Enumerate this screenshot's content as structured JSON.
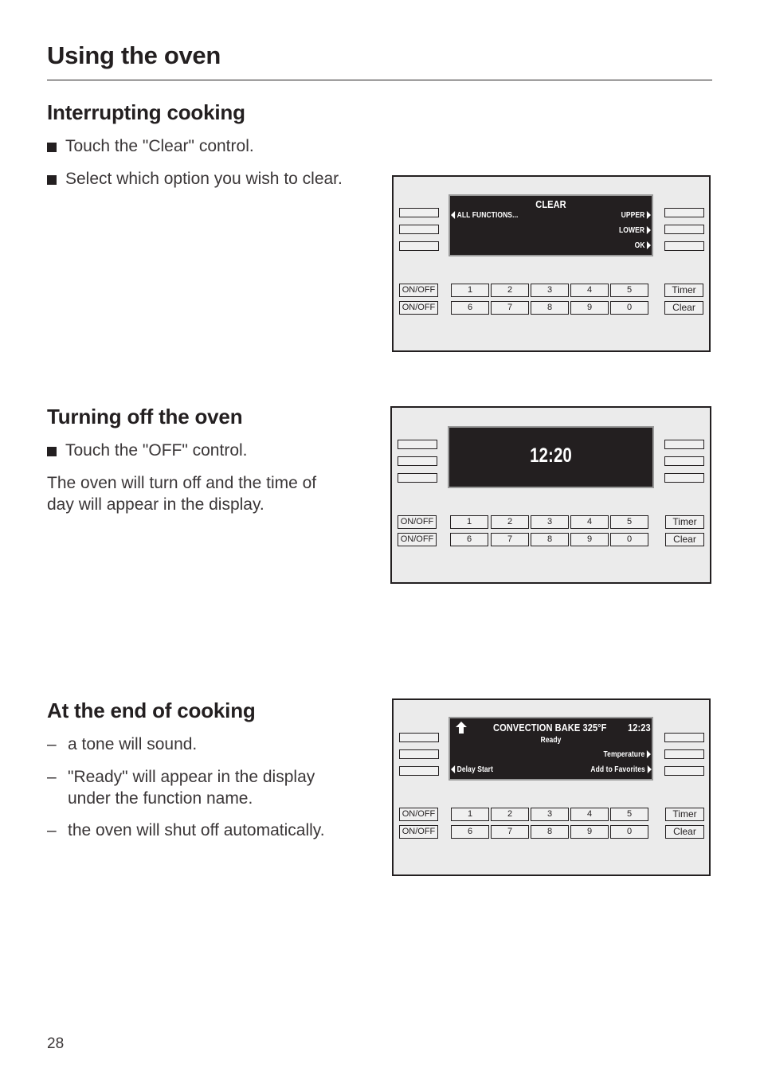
{
  "page": {
    "title": "Using the oven",
    "page_number": "28"
  },
  "sections": [
    {
      "heading": "Interrupting cooking",
      "bullets": [
        "Touch the \"Clear\" control.",
        "Select which option you wish to clear."
      ]
    },
    {
      "heading": "Turning off the oven",
      "bullets": [
        "Touch the \"OFF\" control."
      ],
      "paragraph_lines": [
        "The oven will turn off and the time of",
        "day will appear in the display."
      ]
    },
    {
      "heading": "At the end of cooking",
      "dash_marker": "–",
      "dash_items": [
        [
          "a tone will sound."
        ],
        [
          "\"Ready\" will appear in the display",
          "under the function name."
        ],
        [
          "the oven will shut off automatically."
        ]
      ]
    }
  ],
  "panels": [
    {
      "screen": {
        "title": "CLEAR",
        "left_1": "ALL FUNCTIONS...",
        "right_1": "UPPER",
        "right_2": "LOWER",
        "right_3": "OK"
      }
    },
    {
      "screen": {
        "time": "12:20"
      }
    },
    {
      "screen": {
        "up_arrow_icon": "up-arrow",
        "title": "CONVECTION BAKE 325°F",
        "time": "12:23",
        "status": "Ready",
        "right_2": "Temperature",
        "left_3": "Delay Start",
        "right_3": "Add to Favorites"
      }
    }
  ],
  "keypad": {
    "onoff_labels": [
      "ON/OFF",
      "ON/OFF"
    ],
    "row1": [
      "1",
      "2",
      "3",
      "4",
      "5"
    ],
    "row2": [
      "6",
      "7",
      "8",
      "9",
      "0"
    ],
    "timer_label": "Timer",
    "clear_label": "Clear"
  }
}
